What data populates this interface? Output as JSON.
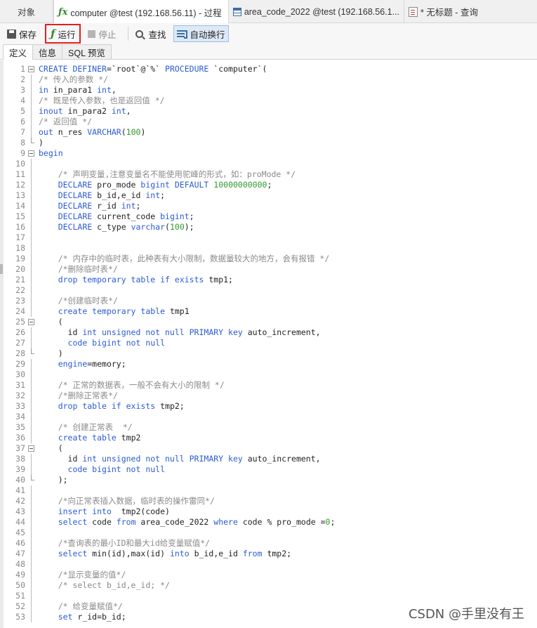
{
  "tabs": [
    {
      "label": "对象",
      "icon": "none"
    },
    {
      "label": "computer @test (192.168.56.11) - 过程",
      "icon": "procedure-icon",
      "active": true
    },
    {
      "label": "area_code_2022 @test (192.168.56.1...",
      "icon": "table-icon"
    },
    {
      "label": "* 无标题 - 查询",
      "icon": "query-icon"
    }
  ],
  "toolbar": {
    "save_label": "保存",
    "run_label": "运行",
    "stop_label": "停止",
    "find_label": "查找",
    "wrap_label": "自动换行"
  },
  "subtabs": [
    {
      "label": "定义",
      "active": true
    },
    {
      "label": "信息"
    },
    {
      "label": "SQL 预览"
    }
  ],
  "colors": {
    "keyword": "#2b5bd6",
    "comment": "#8a8a8a",
    "number": "#2e9a2e",
    "text": "#1f1f1f",
    "highlight_box": "#e02020"
  },
  "code_lines": [
    {
      "n": "1",
      "fold": "open",
      "segments": [
        [
          "kw",
          "CREATE DEFINER"
        ],
        [
          "tx",
          "=`root`@`%` "
        ],
        [
          "kw",
          "PROCEDURE"
        ],
        [
          "tx",
          " `computer`("
        ]
      ]
    },
    {
      "n": "2",
      "fold": "line",
      "segments": [
        [
          "cm",
          "/* 传入的参数 */"
        ]
      ]
    },
    {
      "n": "3",
      "fold": "line",
      "segments": [
        [
          "kw",
          "in"
        ],
        [
          "tx",
          " in_para1 "
        ],
        [
          "kw",
          "int"
        ],
        [
          "tx",
          ","
        ]
      ]
    },
    {
      "n": "4",
      "fold": "line",
      "segments": [
        [
          "cm",
          "/* 既是传入参数，也是返回值 */"
        ]
      ]
    },
    {
      "n": "5",
      "fold": "line",
      "segments": [
        [
          "kw",
          "inout"
        ],
        [
          "tx",
          " in_para2 "
        ],
        [
          "kw",
          "int"
        ],
        [
          "tx",
          ","
        ]
      ]
    },
    {
      "n": "6",
      "fold": "line",
      "segments": [
        [
          "cm",
          "/* 返回值 */"
        ]
      ]
    },
    {
      "n": "7",
      "fold": "line",
      "segments": [
        [
          "kw",
          "out"
        ],
        [
          "tx",
          " n_res "
        ],
        [
          "kw",
          "VARCHAR"
        ],
        [
          "tx",
          "("
        ],
        [
          "nm",
          "100"
        ],
        [
          "tx",
          ")"
        ]
      ]
    },
    {
      "n": "8",
      "fold": "end",
      "segments": [
        [
          "tx",
          ")"
        ]
      ]
    },
    {
      "n": "9",
      "fold": "open",
      "segments": [
        [
          "kw",
          "begin"
        ]
      ]
    },
    {
      "n": "10",
      "fold": "line",
      "segments": [
        [
          "tx",
          ""
        ]
      ]
    },
    {
      "n": "11",
      "fold": "line",
      "segments": [
        [
          "tx",
          "    "
        ],
        [
          "cm",
          "/* 声明变量,注意变量名不能使用驼峰的形式，如：proMode */"
        ]
      ]
    },
    {
      "n": "12",
      "fold": "line",
      "segments": [
        [
          "tx",
          "    "
        ],
        [
          "kw",
          "DECLARE"
        ],
        [
          "tx",
          " pro_mode "
        ],
        [
          "kw",
          "bigint DEFAULT"
        ],
        [
          "tx",
          " "
        ],
        [
          "nm",
          "10000000000"
        ],
        [
          "tx",
          ";"
        ]
      ]
    },
    {
      "n": "13",
      "fold": "line",
      "segments": [
        [
          "tx",
          "    "
        ],
        [
          "kw",
          "DECLARE"
        ],
        [
          "tx",
          " b_id,e_id "
        ],
        [
          "kw",
          "int"
        ],
        [
          "tx",
          ";"
        ]
      ]
    },
    {
      "n": "14",
      "fold": "line",
      "segments": [
        [
          "tx",
          "    "
        ],
        [
          "kw",
          "DECLARE"
        ],
        [
          "tx",
          " r_id "
        ],
        [
          "kw",
          "int"
        ],
        [
          "tx",
          ";"
        ]
      ]
    },
    {
      "n": "15",
      "fold": "line",
      "segments": [
        [
          "tx",
          "    "
        ],
        [
          "kw",
          "DECLARE"
        ],
        [
          "tx",
          " current_code "
        ],
        [
          "kw",
          "bigint"
        ],
        [
          "tx",
          ";"
        ]
      ]
    },
    {
      "n": "16",
      "fold": "line",
      "segments": [
        [
          "tx",
          "    "
        ],
        [
          "kw",
          "DECLARE"
        ],
        [
          "tx",
          " c_type "
        ],
        [
          "kw",
          "varchar"
        ],
        [
          "tx",
          "("
        ],
        [
          "nm",
          "100"
        ],
        [
          "tx",
          ");"
        ]
      ]
    },
    {
      "n": "17",
      "fold": "line",
      "segments": [
        [
          "tx",
          ""
        ]
      ]
    },
    {
      "n": "18",
      "fold": "line",
      "segments": [
        [
          "tx",
          ""
        ]
      ]
    },
    {
      "n": "19",
      "fold": "line",
      "segments": [
        [
          "tx",
          "    "
        ],
        [
          "cm",
          "/* 内存中的临时表，此种表有大小限制，数据量较大的地方，会有报错 */"
        ]
      ]
    },
    {
      "n": "20",
      "fold": "line",
      "segments": [
        [
          "tx",
          "    "
        ],
        [
          "cm",
          "/*删除临时表*/"
        ]
      ]
    },
    {
      "n": "21",
      "fold": "line",
      "segments": [
        [
          "tx",
          "    "
        ],
        [
          "kw",
          "drop temporary table if exists"
        ],
        [
          "tx",
          " tmp1;"
        ]
      ]
    },
    {
      "n": "22",
      "fold": "line",
      "segments": [
        [
          "tx",
          ""
        ]
      ]
    },
    {
      "n": "23",
      "fold": "line",
      "segments": [
        [
          "tx",
          "    "
        ],
        [
          "cm",
          "/*创建临时表*/"
        ]
      ]
    },
    {
      "n": "24",
      "fold": "line",
      "segments": [
        [
          "tx",
          "    "
        ],
        [
          "kw",
          "create temporary table"
        ],
        [
          "tx",
          " tmp1"
        ]
      ]
    },
    {
      "n": "25",
      "fold": "open",
      "segments": [
        [
          "tx",
          "    ("
        ]
      ]
    },
    {
      "n": "26",
      "fold": "line",
      "segments": [
        [
          "tx",
          "      id "
        ],
        [
          "kw",
          "int unsigned not null PRIMARY key"
        ],
        [
          "tx",
          " auto_increment,"
        ]
      ]
    },
    {
      "n": "27",
      "fold": "line",
      "segments": [
        [
          "tx",
          "      "
        ],
        [
          "kw",
          "code bigint not null"
        ]
      ]
    },
    {
      "n": "28",
      "fold": "end",
      "segments": [
        [
          "tx",
          "    )"
        ]
      ]
    },
    {
      "n": "29",
      "fold": "line",
      "segments": [
        [
          "tx",
          "    "
        ],
        [
          "kw",
          "engine"
        ],
        [
          "tx",
          "=memory;"
        ]
      ]
    },
    {
      "n": "30",
      "fold": "line",
      "segments": [
        [
          "tx",
          ""
        ]
      ]
    },
    {
      "n": "31",
      "fold": "line",
      "segments": [
        [
          "tx",
          "    "
        ],
        [
          "cm",
          "/* 正常的数据表，一般不会有大小的限制 */"
        ]
      ]
    },
    {
      "n": "32",
      "fold": "line",
      "segments": [
        [
          "tx",
          "    "
        ],
        [
          "cm",
          "/*删除正常表*/"
        ]
      ]
    },
    {
      "n": "33",
      "fold": "line",
      "segments": [
        [
          "tx",
          "    "
        ],
        [
          "kw",
          "drop table if exists"
        ],
        [
          "tx",
          " tmp2;"
        ]
      ]
    },
    {
      "n": "34",
      "fold": "line",
      "segments": [
        [
          "tx",
          ""
        ]
      ]
    },
    {
      "n": "35",
      "fold": "line",
      "segments": [
        [
          "tx",
          "    "
        ],
        [
          "cm",
          "/* 创建正常表  */"
        ]
      ]
    },
    {
      "n": "36",
      "fold": "line",
      "segments": [
        [
          "tx",
          "    "
        ],
        [
          "kw",
          "create table"
        ],
        [
          "tx",
          " tmp2"
        ]
      ]
    },
    {
      "n": "37",
      "fold": "open",
      "segments": [
        [
          "tx",
          "    ("
        ]
      ]
    },
    {
      "n": "38",
      "fold": "line",
      "segments": [
        [
          "tx",
          "      id "
        ],
        [
          "kw",
          "int unsigned not null PRIMARY key"
        ],
        [
          "tx",
          " auto_increment,"
        ]
      ]
    },
    {
      "n": "39",
      "fold": "line",
      "segments": [
        [
          "tx",
          "      "
        ],
        [
          "kw",
          "code bigint not null"
        ]
      ]
    },
    {
      "n": "40",
      "fold": "end",
      "segments": [
        [
          "tx",
          "    );"
        ]
      ]
    },
    {
      "n": "41",
      "fold": "line",
      "segments": [
        [
          "tx",
          ""
        ]
      ]
    },
    {
      "n": "42",
      "fold": "line",
      "segments": [
        [
          "tx",
          "    "
        ],
        [
          "cm",
          "/*向正常表插入数据，临时表的操作雷同*/"
        ]
      ]
    },
    {
      "n": "43",
      "fold": "line",
      "segments": [
        [
          "tx",
          "    "
        ],
        [
          "kw",
          "insert into"
        ],
        [
          "tx",
          "  tmp2(code)"
        ]
      ]
    },
    {
      "n": "44",
      "fold": "line",
      "segments": [
        [
          "tx",
          "    "
        ],
        [
          "kw",
          "select"
        ],
        [
          "tx",
          " code "
        ],
        [
          "kw",
          "from"
        ],
        [
          "tx",
          " area_code_2022 "
        ],
        [
          "kw",
          "where"
        ],
        [
          "tx",
          " code % pro_mode ="
        ],
        [
          "nm",
          "0"
        ],
        [
          "tx",
          ";"
        ]
      ]
    },
    {
      "n": "45",
      "fold": "line",
      "segments": [
        [
          "tx",
          ""
        ]
      ]
    },
    {
      "n": "46",
      "fold": "line",
      "segments": [
        [
          "tx",
          "    "
        ],
        [
          "cm",
          "/*查询表的最小ID和最大id给变量赋值*/"
        ]
      ]
    },
    {
      "n": "47",
      "fold": "line",
      "segments": [
        [
          "tx",
          "    "
        ],
        [
          "kw",
          "select"
        ],
        [
          "tx",
          " min(id),max(id) "
        ],
        [
          "kw",
          "into"
        ],
        [
          "tx",
          " b_id,e_id "
        ],
        [
          "kw",
          "from"
        ],
        [
          "tx",
          " tmp2;"
        ]
      ]
    },
    {
      "n": "48",
      "fold": "line",
      "segments": [
        [
          "tx",
          ""
        ]
      ]
    },
    {
      "n": "49",
      "fold": "line",
      "segments": [
        [
          "tx",
          "    "
        ],
        [
          "cm",
          "/*显示变量的值*/"
        ]
      ]
    },
    {
      "n": "50",
      "fold": "line",
      "segments": [
        [
          "tx",
          "    "
        ],
        [
          "cm",
          "/* select b_id,e_id; */"
        ]
      ]
    },
    {
      "n": "51",
      "fold": "line",
      "segments": [
        [
          "tx",
          ""
        ]
      ]
    },
    {
      "n": "52",
      "fold": "line",
      "segments": [
        [
          "tx",
          "    "
        ],
        [
          "cm",
          "/* 给变量赋值*/"
        ]
      ]
    },
    {
      "n": "53",
      "fold": "line",
      "segments": [
        [
          "tx",
          "    "
        ],
        [
          "kw",
          "set"
        ],
        [
          "tx",
          " r_id=b_id;"
        ]
      ]
    }
  ],
  "watermark": "CSDN @手里没有王"
}
